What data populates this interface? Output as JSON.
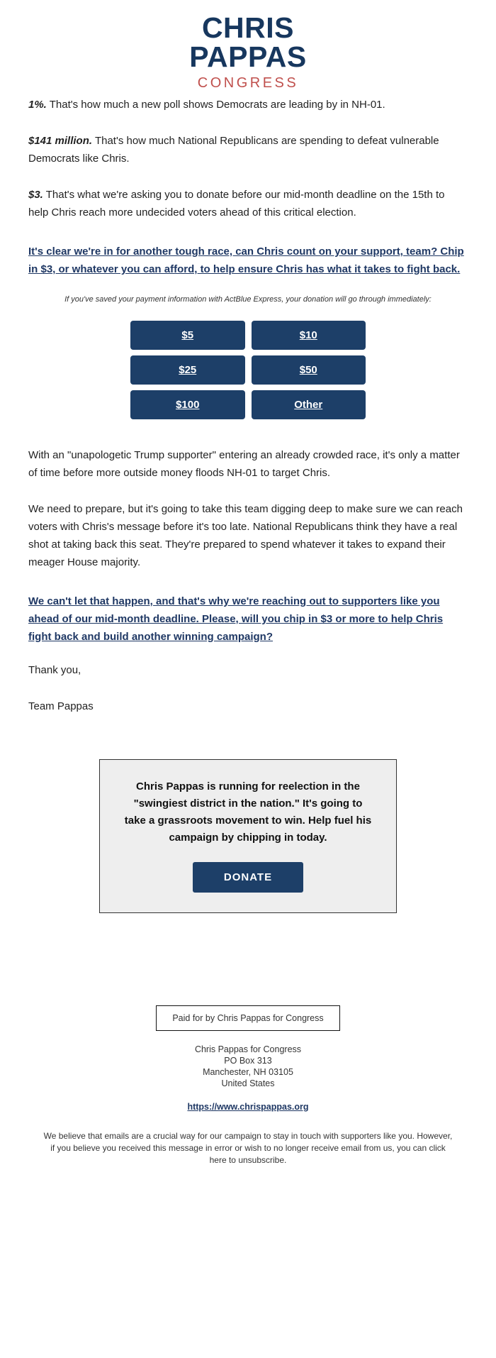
{
  "brand": {
    "logo_line1": "CHRIS",
    "logo_line2": "PAPPAS",
    "logo_line3": "CONGRESS",
    "navy": "#17375e",
    "red": "#c0504d",
    "button_navy": "#1d3f68",
    "link_navy": "#1f3864"
  },
  "paragraphs": {
    "p1_lead": "1%.",
    "p1_rest": " That's how much a new poll shows Democrats are leading by in NH-01.",
    "p2_lead": "$141 million.",
    "p2_rest": " That's how much National Republicans are spending to defeat vulnerable Democrats like Chris.",
    "p3_lead": "$3.",
    "p3_rest": " That's what we're asking you to donate before our mid-month deadline on the 15th to help Chris reach more undecided voters ahead of this critical election.",
    "link1": "It's clear we're in for another tough race, can Chris count on your support, team? Chip in $3, or whatever you can afford, to help ensure Chris has what it takes to fight back.",
    "p4": "With an \"unapologetic Trump supporter\" entering an already crowded race, it's only a matter of time before more outside money floods NH-01 to target Chris.",
    "p5": "We need to prepare, but it's going to take this team digging deep to make sure we can reach voters with Chris's message before it's too late. National Republicans think they have a real shot at taking back this seat. They're prepared to spend whatever it takes to expand their meager House majority.",
    "link2": "We can't let that happen, and that's why we're reaching out to supporters like you ahead of our mid-month deadline. Please, will you chip in $3 or more to help Chris fight back and build another winning campaign?",
    "signoff1": "Thank you,",
    "signoff2": "Team Pappas"
  },
  "donation": {
    "actblue_note": "If you've saved your payment information with ActBlue Express, your donation will go through immediately:",
    "amounts": [
      {
        "label": "$5"
      },
      {
        "label": "$10"
      },
      {
        "label": "$25"
      },
      {
        "label": "$50"
      },
      {
        "label": "$100"
      },
      {
        "label": "Other"
      }
    ]
  },
  "callout": {
    "text": "Chris Pappas is running for reelection in the \"swingiest district in the nation.\" It's going to take a grassroots movement to win. Help fuel his campaign by chipping in today.",
    "button_label": "DONATE"
  },
  "footer": {
    "paid_for": "Paid for by Chris Pappas for Congress",
    "org": "Chris Pappas for Congress",
    "po_box": "PO Box 313",
    "city_state_zip": "Manchester, NH 03105",
    "country": "United States",
    "website": "https://www.chrispappas.org",
    "disclaimer": "We believe that emails are a crucial way for our campaign to stay in touch with supporters like you. However, if you believe you received this message in error or wish to no longer receive email from us, you can click here to unsubscribe."
  }
}
